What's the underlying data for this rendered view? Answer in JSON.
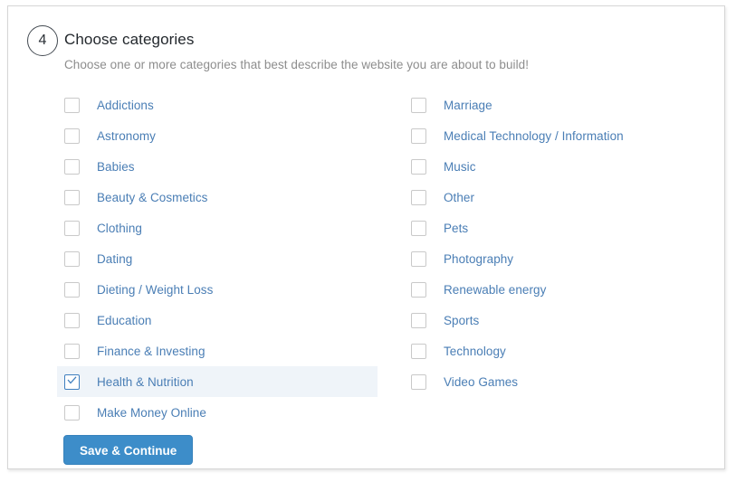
{
  "card": {
    "step_number": "4",
    "title": "Choose categories",
    "subtitle": "Choose one or more categories that best describe the website you are about to build!"
  },
  "colors": {
    "button_blue": "#3d8dc9",
    "label_blue": "#4a7eb5",
    "selected_row_background": "#eff4f9",
    "checkbox_border": "#c9c9c9",
    "checked_border": "#3f7fbf",
    "card_border": "#d6d6d6"
  },
  "categories": {
    "left_column": [
      {
        "label": "Addictions",
        "checked": false
      },
      {
        "label": "Astronomy",
        "checked": false
      },
      {
        "label": "Babies",
        "checked": false
      },
      {
        "label": "Beauty & Cosmetics",
        "checked": false
      },
      {
        "label": "Clothing",
        "checked": false
      },
      {
        "label": "Dating",
        "checked": false
      },
      {
        "label": "Dieting / Weight Loss",
        "checked": false
      },
      {
        "label": "Education",
        "checked": false
      },
      {
        "label": "Finance & Investing",
        "checked": false
      },
      {
        "label": "Health & Nutrition",
        "checked": true
      },
      {
        "label": "Make Money Online",
        "checked": false
      }
    ],
    "right_column": [
      {
        "label": "Marriage",
        "checked": false
      },
      {
        "label": "Medical Technology / Information",
        "checked": false
      },
      {
        "label": "Music",
        "checked": false
      },
      {
        "label": "Other",
        "checked": false
      },
      {
        "label": "Pets",
        "checked": false
      },
      {
        "label": "Photography",
        "checked": false
      },
      {
        "label": "Renewable energy",
        "checked": false
      },
      {
        "label": "Sports",
        "checked": false
      },
      {
        "label": "Technology",
        "checked": false
      },
      {
        "label": "Video Games",
        "checked": false
      }
    ]
  },
  "footer": {
    "save_label": "Save & Continue"
  }
}
